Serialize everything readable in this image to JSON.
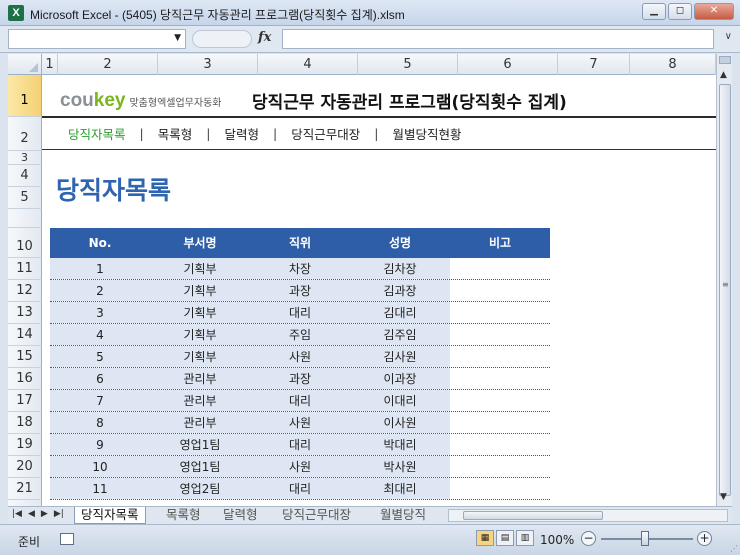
{
  "window": {
    "app_icon": "X",
    "title": "Microsoft Excel - (5405) 당직근무 자동관리 프로그램(당직횟수 집계).xlsm",
    "min_label": "▭",
    "restore_label": "◻",
    "close_label": "✕"
  },
  "formula_bar": {
    "fx_label": "fx",
    "namebox_value": "",
    "formula_value": ""
  },
  "columns": [
    "1",
    "2",
    "3",
    "4",
    "5",
    "6",
    "7",
    "8"
  ],
  "rows": [
    "1",
    "2",
    "3",
    "4",
    "5",
    "10",
    "11",
    "12",
    "13",
    "14",
    "15",
    "16",
    "17",
    "18",
    "19",
    "20",
    "21"
  ],
  "logo": {
    "co": "cou",
    "key": "key",
    "tagline": "맞춤형엑셀업무자동화"
  },
  "heading": "당직근무 자동관리 프로그램(당직횟수 집계)",
  "nav": {
    "items": [
      "당직자목록",
      "목록형",
      "달력형",
      "당직근무대장",
      "월별당직현황"
    ],
    "separator": "|",
    "active_index": 0
  },
  "page_title": "당직자목록",
  "table": {
    "headers": [
      "No.",
      "부서명",
      "직위",
      "성명",
      "비고"
    ],
    "rows": [
      [
        "1",
        "기획부",
        "차장",
        "김차장",
        ""
      ],
      [
        "2",
        "기획부",
        "과장",
        "김과장",
        ""
      ],
      [
        "3",
        "기획부",
        "대리",
        "김대리",
        ""
      ],
      [
        "4",
        "기획부",
        "주임",
        "김주임",
        ""
      ],
      [
        "5",
        "기획부",
        "사원",
        "김사원",
        ""
      ],
      [
        "6",
        "관리부",
        "과장",
        "이과장",
        ""
      ],
      [
        "7",
        "관리부",
        "대리",
        "이대리",
        ""
      ],
      [
        "8",
        "관리부",
        "사원",
        "이사원",
        ""
      ],
      [
        "9",
        "영업1팀",
        "대리",
        "박대리",
        ""
      ],
      [
        "10",
        "영업1팀",
        "사원",
        "박사원",
        ""
      ],
      [
        "11",
        "영업2팀",
        "대리",
        "최대리",
        ""
      ]
    ]
  },
  "sheet_tabs": [
    "당직자목록",
    "목록형",
    "달력형",
    "당직근무대장",
    "월별당직"
  ],
  "status": {
    "ready": "준비",
    "zoom": "100%",
    "zoom_minus": "−",
    "zoom_plus": "+"
  },
  "colors": {
    "accent_blue": "#2e5ea8",
    "title_blue": "#2e64b0",
    "row_fill": "#dde6f2",
    "nav_active": "#2c9d2c",
    "logo_green": "#7ab51d"
  }
}
